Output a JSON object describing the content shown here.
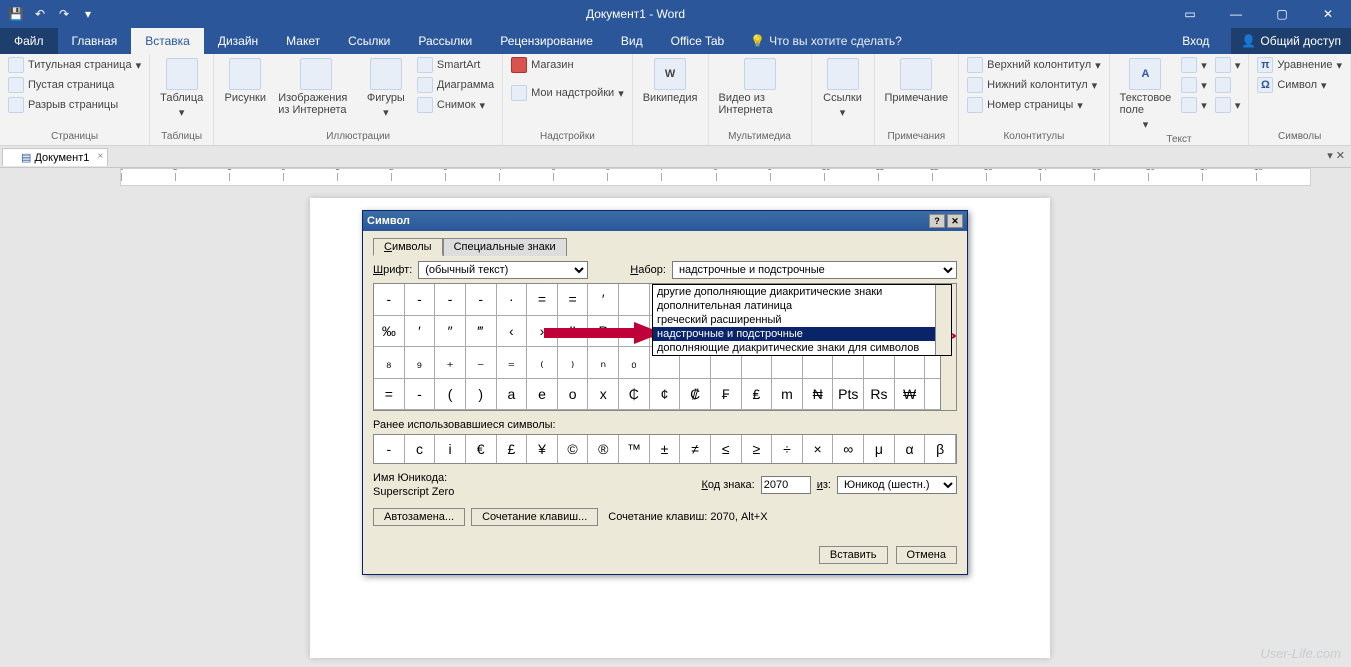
{
  "titlebar": {
    "title": "Документ1 - Word"
  },
  "menu": {
    "file": "Файл",
    "tabs": [
      "Главная",
      "Вставка",
      "Дизайн",
      "Макет",
      "Ссылки",
      "Рассылки",
      "Рецензирование",
      "Вид",
      "Office Tab"
    ],
    "active": "Вставка",
    "tell": "Что вы хотите сделать?",
    "signin": "Вход",
    "share": "Общий доступ"
  },
  "ribbon": {
    "pages": {
      "cover": "Титульная страница",
      "blank": "Пустая страница",
      "break": "Разрыв страницы",
      "label": "Страницы"
    },
    "tables": {
      "table": "Таблица",
      "label": "Таблицы"
    },
    "illus": {
      "pictures": "Рисунки",
      "online": "Изображения из Интернета",
      "shapes": "Фигуры",
      "smartart": "SmartArt",
      "chart": "Диаграмма",
      "screenshot": "Снимок",
      "label": "Иллюстрации"
    },
    "addins": {
      "store": "Магазин",
      "myaddins": "Мои надстройки",
      "label": "Надстройки"
    },
    "wiki": {
      "btn": "Википедия"
    },
    "media": {
      "video": "Видео из Интернета",
      "label": "Мультимедиа"
    },
    "links": {
      "links": "Ссылки",
      "label": ""
    },
    "comments": {
      "btn": "Примечание",
      "label": "Примечания"
    },
    "headerfooter": {
      "header": "Верхний колонтитул",
      "footer": "Нижний колонтитул",
      "pagenum": "Номер страницы",
      "label": "Колонтитулы"
    },
    "text": {
      "textbox": "Текстовое поле",
      "label": "Текст"
    },
    "symbols": {
      "equation": "Уравнение",
      "symbol": "Символ",
      "label": "Символы"
    }
  },
  "doctab": {
    "name": "Документ1"
  },
  "dialog": {
    "title": "Символ",
    "tabs": {
      "symbols": "Символы",
      "special": "Специальные знаки"
    },
    "font_label": "Шрифт:",
    "font_value": "(обычный текст)",
    "set_label": "Набор:",
    "set_value": "надстрочные и подстрочные",
    "dropdown": [
      "другие дополняющие диакритические знаки",
      "дополнительная латиница",
      "греческий расширенный",
      "надстрочные и подстрочные",
      "дополняющие диакритические знаки для символов"
    ],
    "dropdown_selected_index": 3,
    "grid_row1": [
      "-",
      "-",
      "-",
      "-",
      "·",
      "=",
      "=",
      "′",
      "",
      "",
      "",
      "",
      "",
      "",
      "",
      "",
      "",
      "",
      ""
    ],
    "grid_row2": [
      "‰",
      "′",
      "″",
      "‴",
      "‹",
      "›",
      "‼",
      "₱",
      "",
      "",
      "",
      "",
      "",
      "",
      "",
      "",
      "",
      "",
      ""
    ],
    "grid_row3": [
      "₈",
      "₉",
      "₊",
      "₋",
      "₌",
      "₍",
      "₎",
      "ₙ",
      "₀",
      "",
      "",
      "",
      "",
      "",
      "",
      "",
      "",
      "",
      ""
    ],
    "grid_row4": [
      "=",
      "-",
      "(",
      ")",
      "a",
      "e",
      "o",
      "x",
      "₵",
      "¢",
      "₡",
      "₣",
      "₤",
      "m",
      "₦",
      "Pts",
      "Rs",
      "₩",
      ""
    ],
    "recent_label": "Ранее использовавшиеся символы:",
    "recent": [
      "-",
      "c",
      "i",
      "€",
      "£",
      "¥",
      "©",
      "®",
      "™",
      "±",
      "≠",
      "≤",
      "≥",
      "÷",
      "×",
      "∞",
      "μ",
      "α",
      "β"
    ],
    "uname_label": "Имя Юникода:",
    "uname_value": "Superscript Zero",
    "code_label": "Код знака:",
    "code_value": "2070",
    "from_label": "из:",
    "from_value": "Юникод (шестн.)",
    "autocorrect": "Автозамена...",
    "shortcut": "Сочетание клавиш...",
    "shortcut_text": "Сочетание клавиш: 2070, Alt+X",
    "insert": "Вставить",
    "cancel": "Отмена"
  },
  "watermark": "User-Life.com"
}
